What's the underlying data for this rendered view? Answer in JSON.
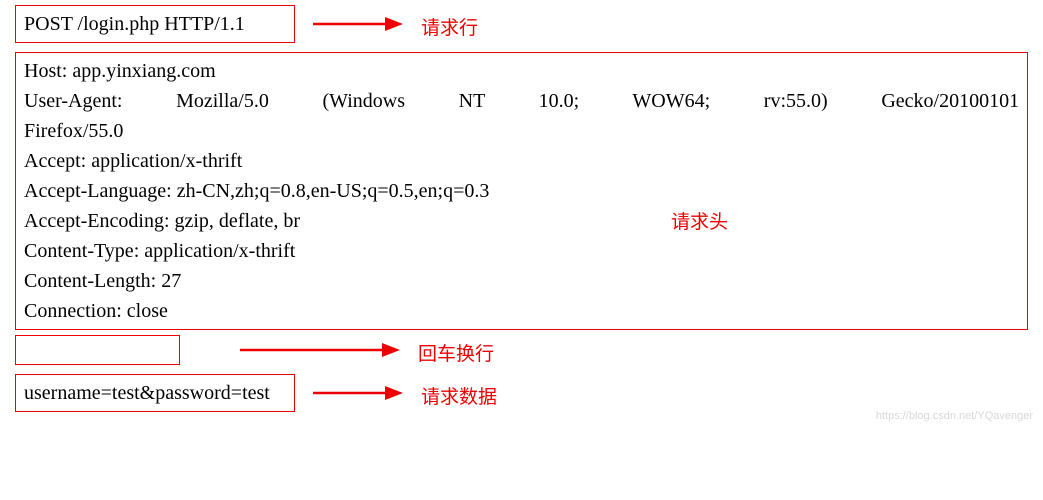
{
  "request_line": "POST /login.php HTTP/1.1",
  "labels": {
    "request_line": "请求行",
    "headers": "请求头",
    "crlf": "回车换行",
    "body": "请求数据"
  },
  "headers": {
    "host": "Host: app.yinxiang.com",
    "user_agent_prefix": "User-Agent:",
    "user_agent_p1": "Mozilla/5.0",
    "user_agent_p2": "(Windows",
    "user_agent_p3": "NT",
    "user_agent_p4": "10.0;",
    "user_agent_p5": "WOW64;",
    "user_agent_p6": "rv:55.0)",
    "user_agent_p7": "Gecko/20100101",
    "user_agent_line2": "Firefox/55.0",
    "accept": "Accept: application/x-thrift",
    "accept_language": "Accept-Language: zh-CN,zh;q=0.8,en-US;q=0.5,en;q=0.3",
    "accept_encoding": "Accept-Encoding: gzip, deflate, br",
    "content_type": "Content-Type: application/x-thrift",
    "content_length": "Content-Length: 27",
    "connection": "Connection: close"
  },
  "body": "username=test&password=test",
  "watermark": "https://blog.csdn.net/YQavenger"
}
